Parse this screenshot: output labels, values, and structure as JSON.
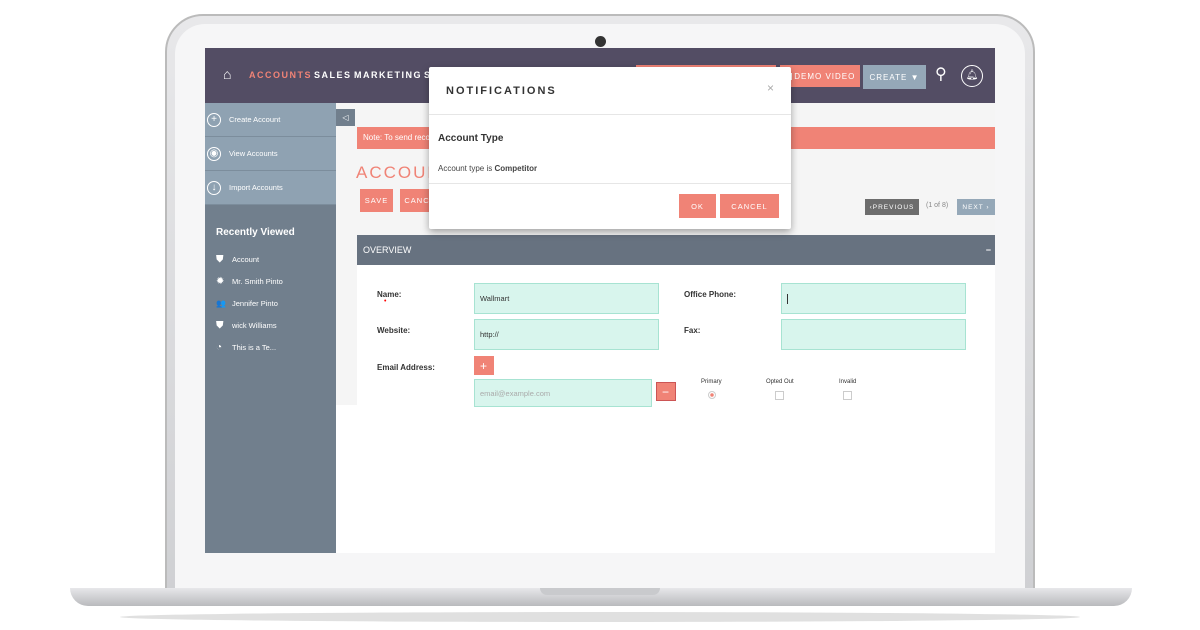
{
  "nav": {
    "items": [
      "ACCOUNTS",
      "SALES",
      "MARKETING",
      "S"
    ],
    "demo_video": "DEMO VIDEO",
    "create": "CREATE ▼"
  },
  "sidebar": {
    "actions": [
      {
        "label": "Create Account",
        "icon": "+"
      },
      {
        "label": "View Accounts",
        "icon": "◉"
      },
      {
        "label": "Import Accounts",
        "icon": "↓"
      }
    ],
    "recently_viewed_title": "Recently Viewed",
    "recent": [
      {
        "label": "Account",
        "icon": "⛊"
      },
      {
        "label": "Mr. Smith Pinto",
        "icon": "✹"
      },
      {
        "label": "Jennifer Pinto",
        "icon": "👥"
      },
      {
        "label": "wick Williams",
        "icon": "⛊"
      },
      {
        "label": "This is a Te...",
        "icon": "◔"
      }
    ]
  },
  "main": {
    "note": "Note: To send reco",
    "title": "ACCOUN",
    "save": "SAVE",
    "cancel": "CANC",
    "previous": "‹PREVIOUS",
    "page_count": "(1 of 8)",
    "next": "NEXT ›"
  },
  "overview": {
    "title": "OVERVIEW",
    "collapse": "−",
    "name_label": "Name:",
    "name_value": "Wallmart",
    "website_label": "Website:",
    "website_value": "http://",
    "email_label": "Email Address:",
    "email_placeholder": "email@example.com",
    "office_phone_label": "Office Phone:",
    "fax_label": "Fax:",
    "primary": "Primary",
    "opted_out": "Opted Out",
    "invalid": "Invalid"
  },
  "modal": {
    "title": "NOTIFICATIONS",
    "close": "×",
    "heading": "Account Type",
    "message_prefix": "Account type is ",
    "message_value": "Competitor",
    "ok": "OK",
    "cancel": "CANCEL"
  },
  "colors": {
    "accent": "#f08376",
    "topbar": "#534d64",
    "sidebar": "#717f8d",
    "input": "#d8f5ed"
  }
}
